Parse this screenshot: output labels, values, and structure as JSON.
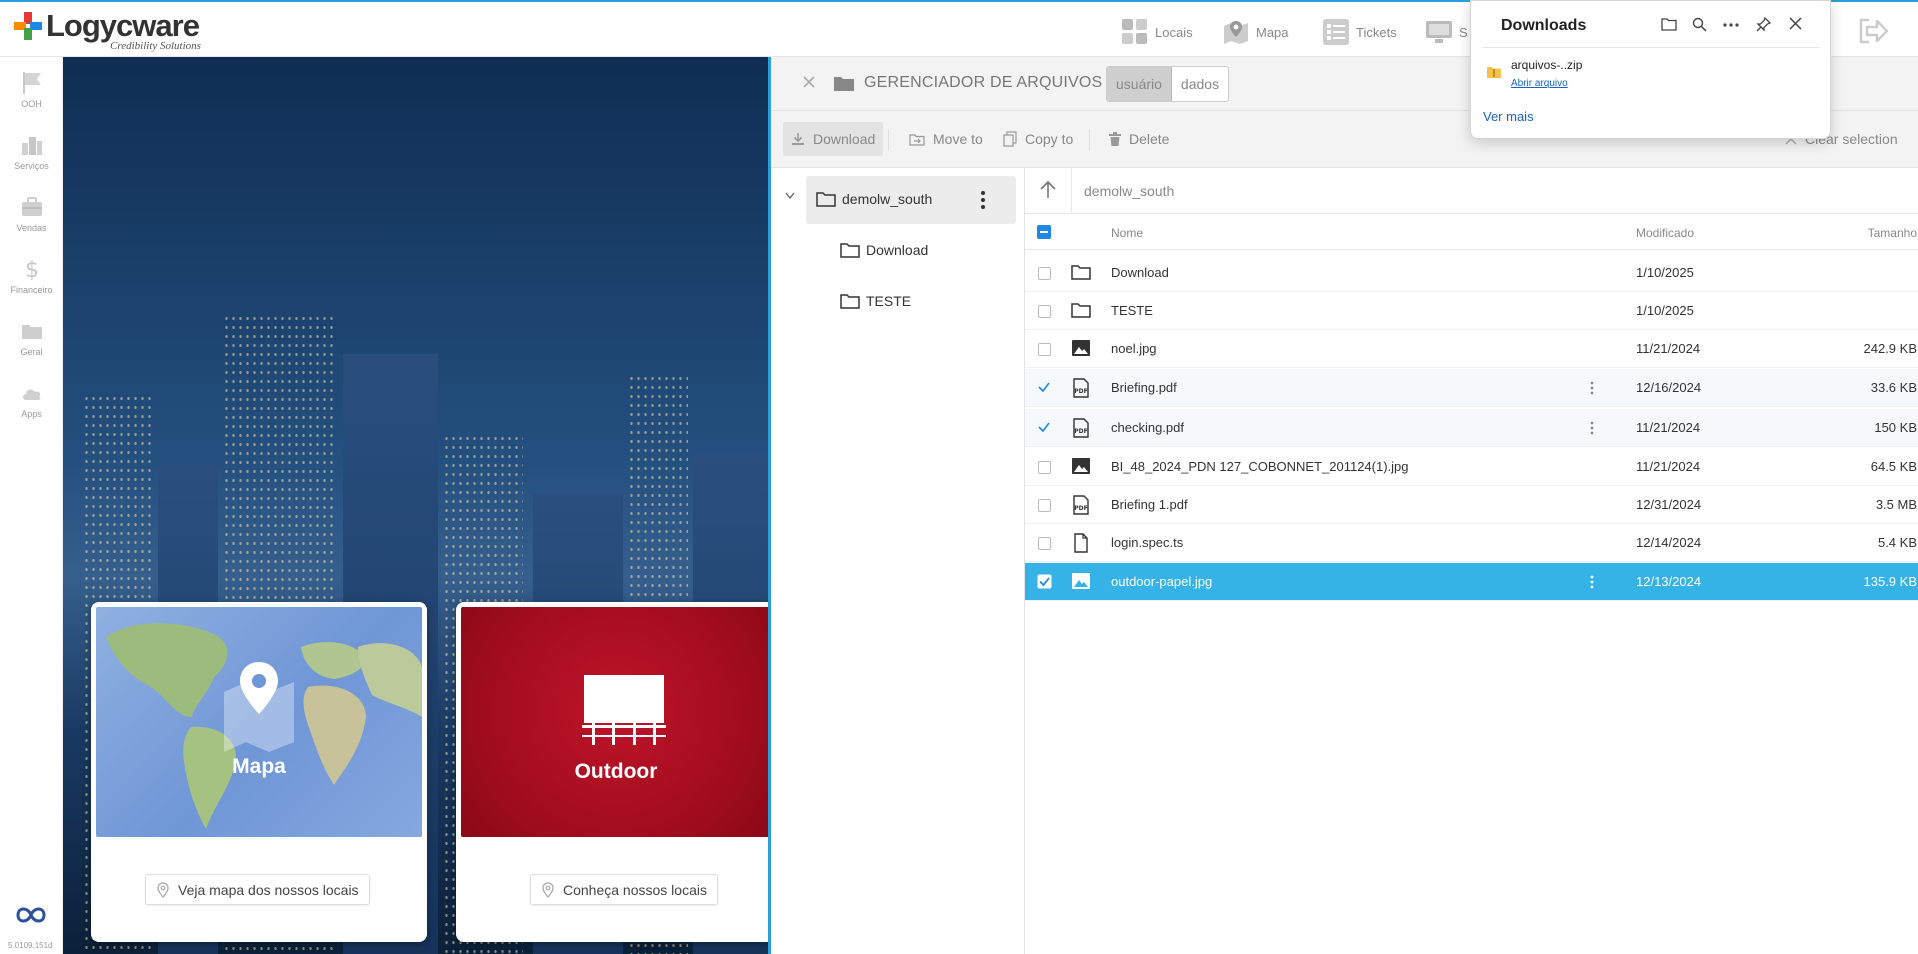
{
  "brand": {
    "name": "Logycware",
    "tagline": "Credibility Solutions",
    "cross_colors": [
      "#e53935",
      "#43a047",
      "#1e88e5",
      "#fb8c00"
    ]
  },
  "topnav": [
    {
      "label": "Locais",
      "icon": "grid-icon"
    },
    {
      "label": "Mapa",
      "icon": "map-icon"
    },
    {
      "label": "Tickets",
      "icon": "checklist-icon"
    },
    {
      "label": "S",
      "icon": "monitor-icon"
    }
  ],
  "sidebar": {
    "items": [
      {
        "label": "OOH",
        "icon": "flag-icon"
      },
      {
        "label": "Serviços",
        "icon": "buildings-icon"
      },
      {
        "label": "Vendas",
        "icon": "briefcase-icon"
      },
      {
        "label": "Financeiro",
        "icon": "dollar-icon"
      },
      {
        "label": "Geral",
        "icon": "folder-icon"
      },
      {
        "label": "Apps",
        "icon": "cloud-icon"
      }
    ],
    "version": "5.0109.151d"
  },
  "cards": [
    {
      "title": "Mapa",
      "button": "Veja mapa dos nossos locais"
    },
    {
      "title": "Outdoor",
      "button": "Conheça nossos locais"
    }
  ],
  "file_manager": {
    "title": "GERENCIADOR DE ARQUIVOS",
    "segments": [
      "usuário",
      "dados"
    ],
    "toolbar": {
      "download": "Download",
      "move": "Move to",
      "copy": "Copy to",
      "delete": "Delete",
      "clear": "Clear selection"
    },
    "tree": {
      "root": "demolw_south",
      "children": [
        "Download",
        "TESTE"
      ]
    },
    "path": "demolw_south",
    "columns": {
      "name": "Nome",
      "modified": "Modificado",
      "size": "Tamanho"
    },
    "files": [
      {
        "name": "Download",
        "modified": "1/10/2025",
        "size": "",
        "type": "folder",
        "state": "none"
      },
      {
        "name": "TESTE",
        "modified": "1/10/2025",
        "size": "",
        "type": "folder",
        "state": "none"
      },
      {
        "name": "noel.jpg",
        "modified": "11/21/2024",
        "size": "242.9 KB",
        "type": "image",
        "state": "none"
      },
      {
        "name": "Briefing.pdf",
        "modified": "12/16/2024",
        "size": "33.6 KB",
        "type": "pdf",
        "state": "checked"
      },
      {
        "name": "checking.pdf",
        "modified": "11/21/2024",
        "size": "150 KB",
        "type": "pdf",
        "state": "checked"
      },
      {
        "name": "BI_48_2024_PDN 127_COBONNET_201124(1).jpg",
        "modified": "11/21/2024",
        "size": "64.5 KB",
        "type": "image",
        "state": "none"
      },
      {
        "name": "Briefing 1.pdf",
        "modified": "12/31/2024",
        "size": "3.5 MB",
        "type": "pdf",
        "state": "none"
      },
      {
        "name": "login.spec.ts",
        "modified": "12/14/2024",
        "size": "5.4 KB",
        "type": "file",
        "state": "none"
      },
      {
        "name": "outdoor-papel.jpg",
        "modified": "12/13/2024",
        "size": "135.9 KB",
        "type": "image",
        "state": "selected"
      }
    ]
  },
  "downloads_popup": {
    "title": "Downloads",
    "file": "arquivos-..zip",
    "open": "Abrir arquivo",
    "more": "Ver mais"
  },
  "colors": {
    "accent": "#2aa0d6",
    "selected_row": "#35b2e6",
    "outdoor_red": "#b01020",
    "link": "#1a64c8"
  }
}
